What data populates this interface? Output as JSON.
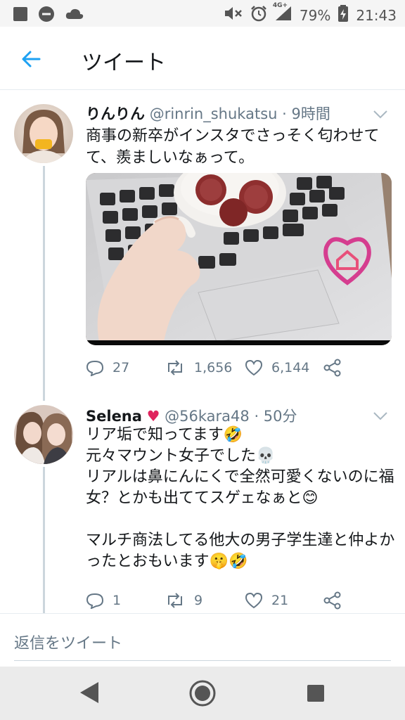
{
  "status_bar": {
    "time": "21:43",
    "battery": "79%",
    "network": "4G+"
  },
  "header": {
    "title": "ツイート"
  },
  "tweets": [
    {
      "name": "りんりん",
      "handle": "@rinrin_shukatsu",
      "time": "· 9時間",
      "text": "商事の新卒がインスタでさっそく匂わせてて、羨ましいなぁって。",
      "replies": "27",
      "retweets": "1,656",
      "likes": "6,144"
    },
    {
      "name": "Selena",
      "name_emoji": "♥",
      "handle": "@56kara48",
      "time": "· 50分",
      "text": "リア垢で知ってます🤣\n元々マウント女子でした💀\nリアルは鼻にんにくで全然可愛くないのに福女？とかも出ててスゲェなぁと😊\n\nマルチ商法してる他大の男子学生達と仲よかったとおもいます🤫🤣",
      "replies": "1",
      "retweets": "9",
      "likes": "21"
    }
  ],
  "reply_bar": {
    "placeholder": "返信をツイート"
  },
  "colors": {
    "accent": "#1da1f2",
    "secondary_text": "#657786",
    "heart_red": "#e0245e"
  }
}
